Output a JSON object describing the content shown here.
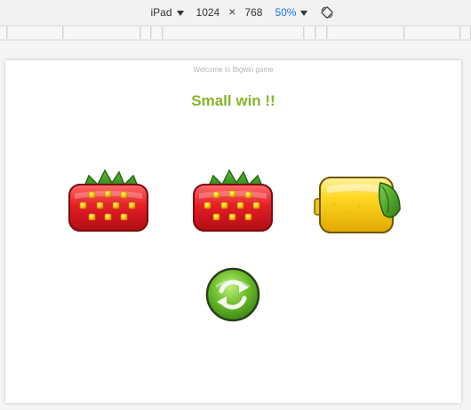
{
  "toolbar": {
    "device": "iPad",
    "width": "1024",
    "times": "×",
    "height": "768",
    "zoom": "50%"
  },
  "game": {
    "welcome": "Welcome to Bigwin game",
    "result": "Small win !!",
    "reels": [
      {
        "symbol": "strawberry"
      },
      {
        "symbol": "strawberry"
      },
      {
        "symbol": "lemon"
      }
    ],
    "spin_icon": "refresh-icon"
  },
  "colors": {
    "result_text": "#86b52a",
    "welcome_text": "#b5b5b5",
    "zoom_text": "#1a73e8"
  }
}
